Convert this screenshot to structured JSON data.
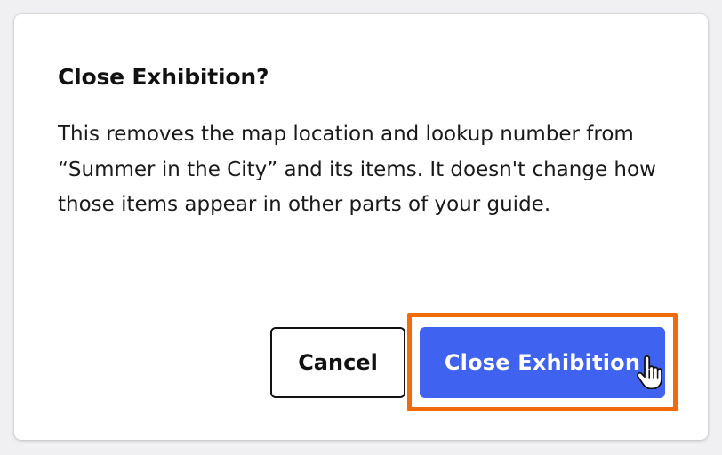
{
  "dialog": {
    "title": "Close Exhibition?",
    "body": "This removes the map location and lookup number from “Summer in the City” and its items. It doesn't change how those items appear in other parts of your guide.",
    "cancel_label": "Cancel",
    "confirm_label": "Close Exhibition"
  },
  "colors": {
    "primary": "#3f62f1",
    "highlight": "#f06b0a"
  },
  "icons": {
    "cursor": "hand-pointer-icon"
  }
}
